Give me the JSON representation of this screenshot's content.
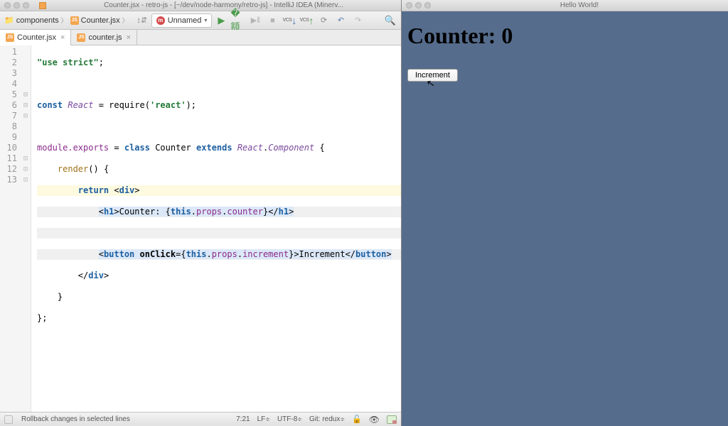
{
  "left_window": {
    "title": "Counter.jsx - retro-js - [~/dev/node-harmony/retro-js] - IntelliJ IDEA (Minerv...",
    "breadcrumb": {
      "folder": "components",
      "file": "Counter.jsx"
    },
    "run_config": "Unnamed",
    "tabs": [
      {
        "label": "Counter.jsx",
        "active": true
      },
      {
        "label": "counter.js",
        "active": false
      }
    ],
    "code": {
      "l1_str": "\"use strict\"",
      "l3_kw": "const",
      "l3_id": "React",
      "l3_req": "require",
      "l3_mod": "'react'",
      "l5_me": "module.exports",
      "l5_cls": "class",
      "l5_name": "Counter",
      "l5_ext": "extends",
      "l5_r": "React",
      "l5_c": "Component",
      "l6_fn": "render",
      "l7_ret": "return",
      "l7_tag": "div",
      "l8_tag": "h1",
      "l8_txt": "Counter: ",
      "l8_this": "this",
      "l8_props": "props",
      "l8_counter": "counter",
      "l10_tag": "button",
      "l10_oc": "onClick",
      "l10_this": "this",
      "l10_props": "props",
      "l10_inc": "increment",
      "l10_txt": "Increment"
    },
    "statusbar": {
      "hint": "Rollback changes in selected lines",
      "pos": "7:21",
      "le": "LF",
      "enc": "UTF-8",
      "git": "Git: redux"
    }
  },
  "right_window": {
    "title": "Hello World!",
    "heading": "Counter: 0",
    "button": "Increment"
  },
  "line_numbers": [
    "1",
    "2",
    "3",
    "4",
    "5",
    "6",
    "7",
    "8",
    "9",
    "10",
    "11",
    "12",
    "13"
  ]
}
